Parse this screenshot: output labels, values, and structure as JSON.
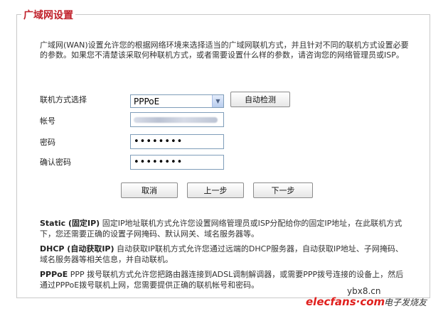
{
  "title": "广域网设置",
  "intro": "广域网(WAN)设置允许您的根据网络环境来选择适当的广域网联机方式，并且针对不同的联机方式设置必要的参数。如果您不清楚该采取何种联机方式，或者需要设置什么样的参数，请咨询您的网络管理员或ISP。",
  "form": {
    "connection_label": "联机方式选择",
    "connection_value": "PPPoE",
    "detect_button": "自动检测",
    "username_label": "帐号",
    "password_label": "密码",
    "password_value": "••••••••",
    "confirm_label": "确认密码",
    "confirm_value": "••••••••"
  },
  "buttons": {
    "cancel": "取消",
    "prev": "上一步",
    "next": "下一步"
  },
  "descriptions": [
    {
      "title": "Static (固定IP)",
      "text": " 固定IP地址联机方式允许您设置网络管理员或ISP分配给你的固定IP地址，在此联机方式下，您还需要正确的设置子网掩码、默认网关、域名服务器等。"
    },
    {
      "title": "DHCP (自动获取IP)",
      "text": " 自动获取IP联机方式允许您通过远端的DHCP服务器，自动获取IP地址、子网掩码、域名服务器等相关信息，并自动联机。"
    },
    {
      "title": "PPPoE",
      "text": " PPP 拨号联机方式允许您把路由器连接到ADSL调制解调器，或需要PPP拨号连接的设备上，然后通过PPPoE拨号联机上网，您需要提供正确的联机帐号和密码。"
    }
  ],
  "watermark": {
    "site": "ybx8.cn",
    "logo": "elecfans·com",
    "tagline": "电子发烧友"
  }
}
